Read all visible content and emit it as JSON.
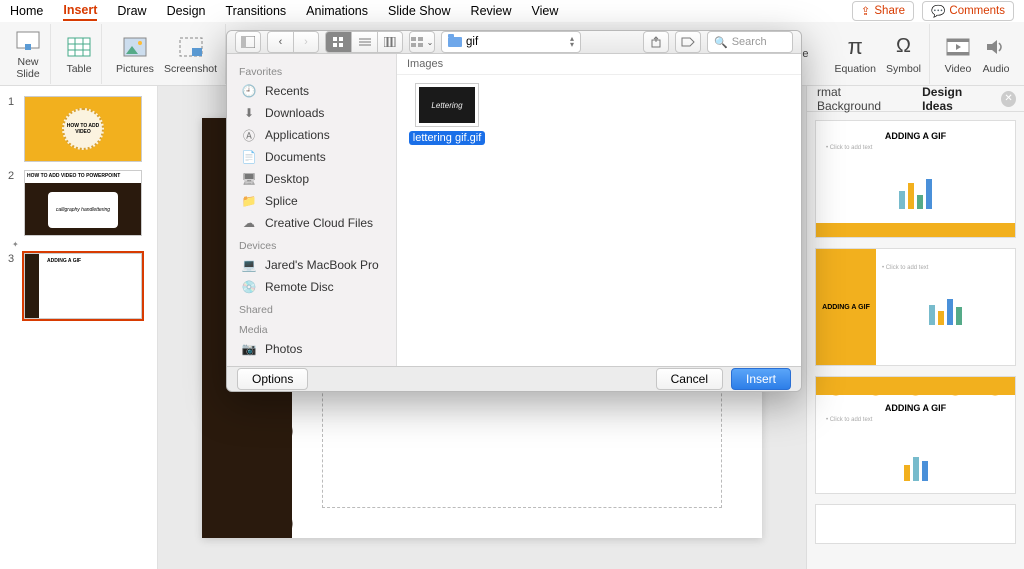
{
  "menubar": {
    "tabs": [
      "Home",
      "Insert",
      "Draw",
      "Design",
      "Transitions",
      "Animations",
      "Slide Show",
      "Review",
      "View"
    ],
    "active_index": 1,
    "share": "Share",
    "comments": "Comments"
  },
  "ribbon": {
    "new_slide": "New\nSlide",
    "table": "Table",
    "pictures": "Pictures",
    "screenshot": "Screenshot",
    "date_time": "Date & Time",
    "equation": "Equation",
    "symbol": "Symbol",
    "video": "Video",
    "audio": "Audio"
  },
  "thumbs": {
    "items": [
      {
        "num": "1",
        "title": "HOW TO ADD VIDEO"
      },
      {
        "num": "2",
        "title": "HOW TO ADD VIDEO TO POWERPOINT",
        "sub": "calligraphy handlettering"
      },
      {
        "num": "3",
        "title": "ADDING A GIF"
      }
    ]
  },
  "right_panel": {
    "tab1": "rmat Background",
    "tab2": "Design Ideas",
    "idea_title": "ADDING A GIF",
    "click_text": "• Click to add text"
  },
  "dialog": {
    "folder": "gif",
    "search_placeholder": "Search",
    "content_header": "Images",
    "sidebar": {
      "favorites": "Favorites",
      "recents": "Recents",
      "downloads": "Downloads",
      "applications": "Applications",
      "documents": "Documents",
      "desktop": "Desktop",
      "splice": "Splice",
      "ccf": "Creative Cloud Files",
      "devices": "Devices",
      "macbook": "Jared's MacBook Pro",
      "remote": "Remote Disc",
      "shared": "Shared",
      "media": "Media",
      "photos": "Photos"
    },
    "file": {
      "name": "lettering gif.gif",
      "thumb_text": "Lettering"
    },
    "options": "Options",
    "cancel": "Cancel",
    "insert": "Insert"
  }
}
